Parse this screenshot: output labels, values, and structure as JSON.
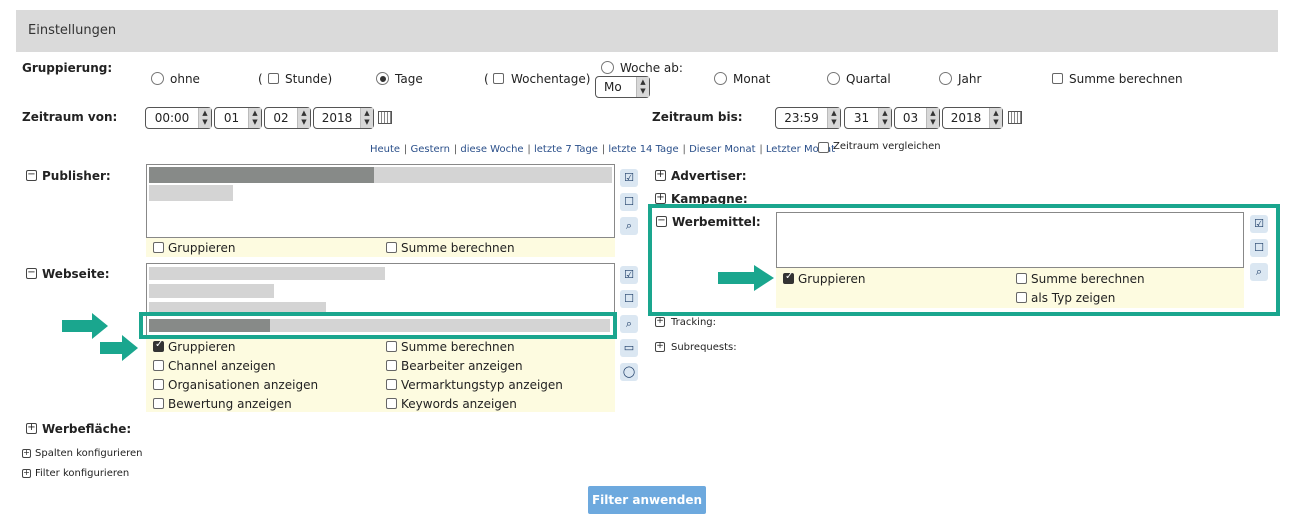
{
  "header": {
    "title": "Einstellungen"
  },
  "grouping": {
    "label": "Gruppierung:",
    "options": {
      "ohne": "ohne",
      "stunde_prefix": "(",
      "stunde": "Stunde)",
      "tage": "Tage",
      "wochentage_prefix": "(",
      "wochentage": "Wochentage)",
      "woche_ab": "Woche ab:",
      "woche_day": "Mo",
      "monat": "Monat",
      "quartal": "Quartal",
      "jahr": "Jahr"
    },
    "summe": "Summe berechnen",
    "selected": "Tage"
  },
  "zeitraum_von": {
    "label": "Zeitraum von:",
    "time": "00:00",
    "day": "01",
    "month": "02",
    "year": "2018"
  },
  "zeitraum_bis": {
    "label": "Zeitraum bis:",
    "time": "23:59",
    "day": "31",
    "month": "03",
    "year": "2018"
  },
  "quick_links": [
    "Heute",
    "Gestern",
    "diese Woche",
    "letzte 7 Tage",
    "letzte 14 Tage",
    "Dieser Monat",
    "Letzter Monat"
  ],
  "compare": "Zeitraum vergleichen",
  "publisher": {
    "label": "Publisher:",
    "gruppieren": "Gruppieren",
    "summe": "Summe berechnen"
  },
  "webseite": {
    "label": "Webseite:",
    "gruppieren": "Gruppieren",
    "summe": "Summe berechnen",
    "channel": "Channel anzeigen",
    "bearbeiter": "Bearbeiter anzeigen",
    "organisationen": "Organisationen anzeigen",
    "vermarktungstyp": "Vermarktungstyp anzeigen",
    "bewertung": "Bewertung anzeigen",
    "keywords": "Keywords anzeigen"
  },
  "werbeflaeche": {
    "label": "Werbefläche:"
  },
  "spalten": "Spalten konfigurieren",
  "filter_config": "Filter konfigurieren",
  "advertiser": {
    "label": "Advertiser:"
  },
  "kampagne": {
    "label": "Kampagne:"
  },
  "werbemittel": {
    "label": "Werbemittel:",
    "gruppieren": "Gruppieren",
    "summe": "Summe berechnen",
    "typ": "als Typ zeigen"
  },
  "tracking": {
    "label": "Tracking:"
  },
  "subrequests": {
    "label": "Subrequests:"
  },
  "apply_button": "Filter anwenden",
  "colors": {
    "accent": "#1aa68e",
    "button": "#6da9de",
    "header": "#dadada",
    "option_bg": "#fdfbe0"
  }
}
